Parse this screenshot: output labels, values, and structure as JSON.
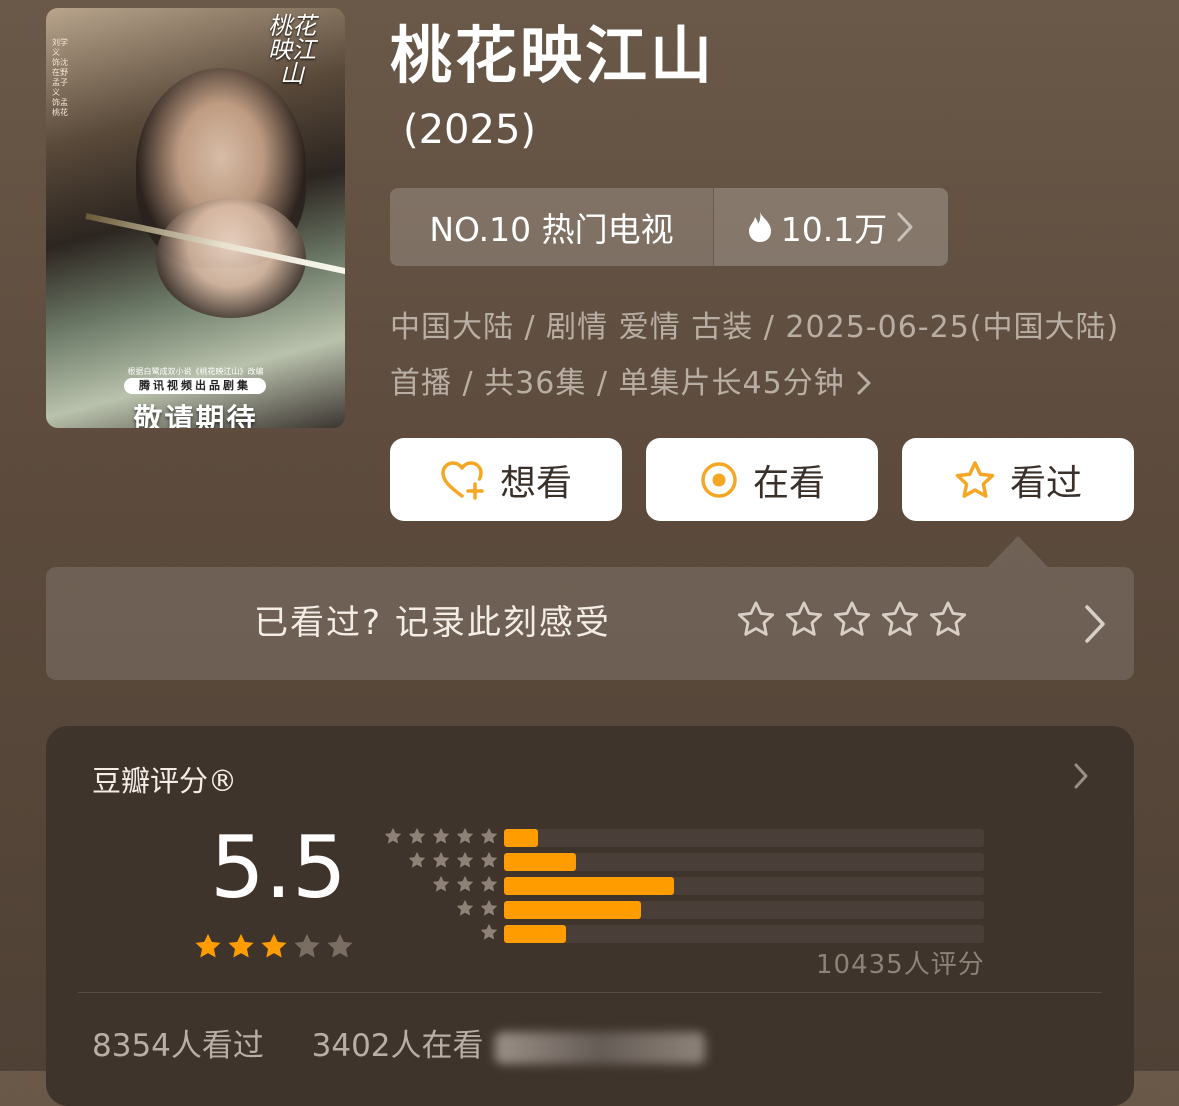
{
  "poster": {
    "title_calligraphy": "桃花映江山",
    "cast_text": "刘学义 饰沈在野 孟子义 饰孟桃花",
    "small_text": "根据白鹭成双小说《桃花映江山》改编",
    "badge": "腾讯视频出品剧集",
    "coming_soon": "敬请期待"
  },
  "header": {
    "title": "桃花映江山",
    "year": "(2025)"
  },
  "ranking": {
    "rank_label": "NO.10 热门电视",
    "heat_value": "10.1万",
    "heat_icon": "flame-icon",
    "chevron_icon": "chevron-right-icon"
  },
  "meta": {
    "info": "中国大陆 / 剧情 爱情 古装 / 2025-06-25(中国大陆) 首播 / 共36集 / 单集片长45分钟"
  },
  "actions": [
    {
      "label": "想看",
      "icon": "heart-plus-icon"
    },
    {
      "label": "在看",
      "icon": "target-circle-icon"
    },
    {
      "label": "看过",
      "icon": "star-outline-icon"
    }
  ],
  "record": {
    "prompt": "已看过? 记录此刻感受",
    "stars": 5
  },
  "rating": {
    "title": "豆瓣评分®",
    "score": "5.5",
    "stars_filled": 3,
    "stars_total": 5,
    "count_text": "10435人评分",
    "distribution": [
      {
        "stars": 5,
        "fraction": 0.07
      },
      {
        "stars": 4,
        "fraction": 0.15
      },
      {
        "stars": 3,
        "fraction": 0.355
      },
      {
        "stars": 2,
        "fraction": 0.285
      },
      {
        "stars": 1,
        "fraction": 0.13
      }
    ],
    "watched_text": "8354人看过",
    "watching_text": "3402人在看"
  },
  "colors": {
    "accent": "#ff9d00",
    "star_empty": "#7a6d62"
  }
}
